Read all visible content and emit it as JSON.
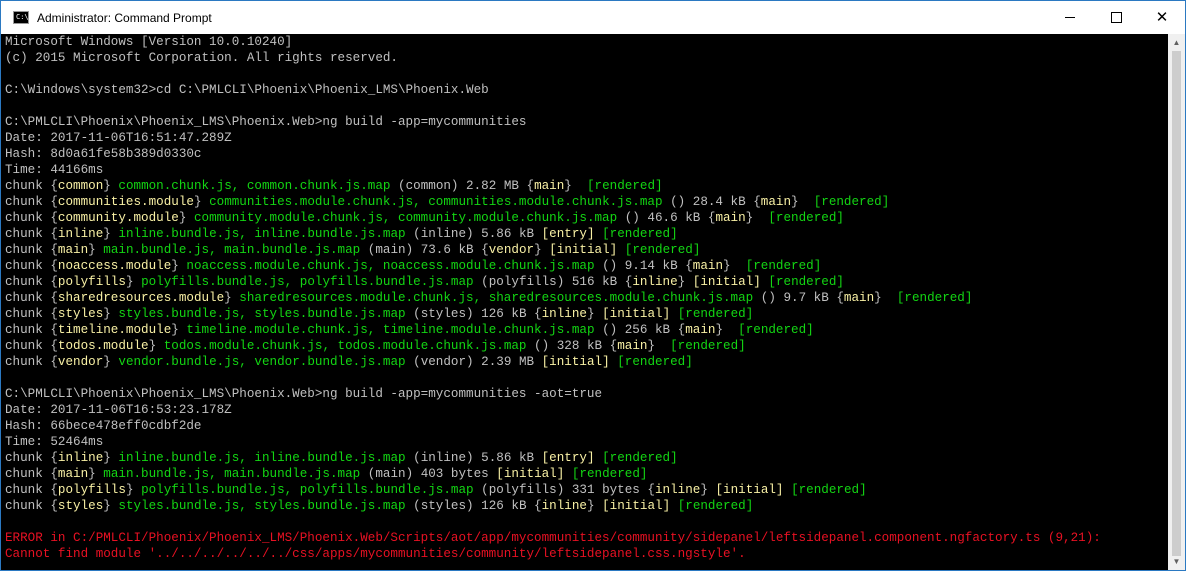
{
  "window": {
    "title": "Administrator: Command Prompt",
    "app_icon_text": "C:\\_",
    "controls": {
      "minimize": "minimize",
      "maximize": "maximize",
      "close": "✕"
    }
  },
  "colors": {
    "gray": "#c0c0c0",
    "green": "#13d613",
    "yellow": "#f9f1a5",
    "red": "#e81123"
  },
  "console": {
    "lines": [
      [
        [
          "gray",
          "Microsoft Windows [Version 10.0.10240]"
        ]
      ],
      [
        [
          "gray",
          "(c) 2015 Microsoft Corporation. All rights reserved."
        ]
      ],
      [],
      [
        [
          "gray",
          "C:\\Windows\\system32>cd C:\\PMLCLI\\Phoenix\\Phoenix_LMS\\Phoenix.Web"
        ]
      ],
      [],
      [
        [
          "gray",
          "C:\\PMLCLI\\Phoenix\\Phoenix_LMS\\Phoenix.Web>ng build -app=mycommunities"
        ]
      ],
      [
        [
          "gray",
          "Date: 2017-11-06T16:51:47.289Z"
        ]
      ],
      [
        [
          "gray",
          "Hash: 8d0a61fe58b389d0330c"
        ]
      ],
      [
        [
          "gray",
          "Time: 44166ms"
        ]
      ],
      [
        [
          "gray",
          "chunk {"
        ],
        [
          "yellow",
          "common"
        ],
        [
          "gray",
          "} "
        ],
        [
          "green",
          "common.chunk.js, common.chunk.js.map"
        ],
        [
          "gray",
          " (common) 2.82 MB {"
        ],
        [
          "yellow",
          "main"
        ],
        [
          "gray",
          "}  "
        ],
        [
          "green",
          "[rendered]"
        ]
      ],
      [
        [
          "gray",
          "chunk {"
        ],
        [
          "yellow",
          "communities.module"
        ],
        [
          "gray",
          "} "
        ],
        [
          "green",
          "communities.module.chunk.js, communities.module.chunk.js.map"
        ],
        [
          "gray",
          " () 28.4 kB {"
        ],
        [
          "yellow",
          "main"
        ],
        [
          "gray",
          "}  "
        ],
        [
          "green",
          "[rendered]"
        ]
      ],
      [
        [
          "gray",
          "chunk {"
        ],
        [
          "yellow",
          "community.module"
        ],
        [
          "gray",
          "} "
        ],
        [
          "green",
          "community.module.chunk.js, community.module.chunk.js.map"
        ],
        [
          "gray",
          " () 46.6 kB {"
        ],
        [
          "yellow",
          "main"
        ],
        [
          "gray",
          "}  "
        ],
        [
          "green",
          "[rendered]"
        ]
      ],
      [
        [
          "gray",
          "chunk {"
        ],
        [
          "yellow",
          "inline"
        ],
        [
          "gray",
          "} "
        ],
        [
          "green",
          "inline.bundle.js, inline.bundle.js.map"
        ],
        [
          "gray",
          " (inline) 5.86 kB "
        ],
        [
          "yellow",
          "[entry]"
        ],
        [
          "gray",
          " "
        ],
        [
          "green",
          "[rendered]"
        ]
      ],
      [
        [
          "gray",
          "chunk {"
        ],
        [
          "yellow",
          "main"
        ],
        [
          "gray",
          "} "
        ],
        [
          "green",
          "main.bundle.js, main.bundle.js.map"
        ],
        [
          "gray",
          " (main) 73.6 kB {"
        ],
        [
          "yellow",
          "vendor"
        ],
        [
          "gray",
          "} "
        ],
        [
          "yellow",
          "[initial]"
        ],
        [
          "gray",
          " "
        ],
        [
          "green",
          "[rendered]"
        ]
      ],
      [
        [
          "gray",
          "chunk {"
        ],
        [
          "yellow",
          "noaccess.module"
        ],
        [
          "gray",
          "} "
        ],
        [
          "green",
          "noaccess.module.chunk.js, noaccess.module.chunk.js.map"
        ],
        [
          "gray",
          " () 9.14 kB {"
        ],
        [
          "yellow",
          "main"
        ],
        [
          "gray",
          "}  "
        ],
        [
          "green",
          "[rendered]"
        ]
      ],
      [
        [
          "gray",
          "chunk {"
        ],
        [
          "yellow",
          "polyfills"
        ],
        [
          "gray",
          "} "
        ],
        [
          "green",
          "polyfills.bundle.js, polyfills.bundle.js.map"
        ],
        [
          "gray",
          " (polyfills) 516 kB {"
        ],
        [
          "yellow",
          "inline"
        ],
        [
          "gray",
          "} "
        ],
        [
          "yellow",
          "[initial]"
        ],
        [
          "gray",
          " "
        ],
        [
          "green",
          "[rendered]"
        ]
      ],
      [
        [
          "gray",
          "chunk {"
        ],
        [
          "yellow",
          "sharedresources.module"
        ],
        [
          "gray",
          "} "
        ],
        [
          "green",
          "sharedresources.module.chunk.js, sharedresources.module.chunk.js.map"
        ],
        [
          "gray",
          " () 9.7 kB {"
        ],
        [
          "yellow",
          "main"
        ],
        [
          "gray",
          "}  "
        ],
        [
          "green",
          "[rendered]"
        ]
      ],
      [
        [
          "gray",
          "chunk {"
        ],
        [
          "yellow",
          "styles"
        ],
        [
          "gray",
          "} "
        ],
        [
          "green",
          "styles.bundle.js, styles.bundle.js.map"
        ],
        [
          "gray",
          " (styles) 126 kB {"
        ],
        [
          "yellow",
          "inline"
        ],
        [
          "gray",
          "} "
        ],
        [
          "yellow",
          "[initial]"
        ],
        [
          "gray",
          " "
        ],
        [
          "green",
          "[rendered]"
        ]
      ],
      [
        [
          "gray",
          "chunk {"
        ],
        [
          "yellow",
          "timeline.module"
        ],
        [
          "gray",
          "} "
        ],
        [
          "green",
          "timeline.module.chunk.js, timeline.module.chunk.js.map"
        ],
        [
          "gray",
          " () 256 kB {"
        ],
        [
          "yellow",
          "main"
        ],
        [
          "gray",
          "}  "
        ],
        [
          "green",
          "[rendered]"
        ]
      ],
      [
        [
          "gray",
          "chunk {"
        ],
        [
          "yellow",
          "todos.module"
        ],
        [
          "gray",
          "} "
        ],
        [
          "green",
          "todos.module.chunk.js, todos.module.chunk.js.map"
        ],
        [
          "gray",
          " () 328 kB {"
        ],
        [
          "yellow",
          "main"
        ],
        [
          "gray",
          "}  "
        ],
        [
          "green",
          "[rendered]"
        ]
      ],
      [
        [
          "gray",
          "chunk {"
        ],
        [
          "yellow",
          "vendor"
        ],
        [
          "gray",
          "} "
        ],
        [
          "green",
          "vendor.bundle.js, vendor.bundle.js.map"
        ],
        [
          "gray",
          " (vendor) 2.39 MB "
        ],
        [
          "yellow",
          "[initial]"
        ],
        [
          "gray",
          " "
        ],
        [
          "green",
          "[rendered]"
        ]
      ],
      [],
      [
        [
          "gray",
          "C:\\PMLCLI\\Phoenix\\Phoenix_LMS\\Phoenix.Web>ng build -app=mycommunities -aot=true"
        ]
      ],
      [
        [
          "gray",
          "Date: 2017-11-06T16:53:23.178Z"
        ]
      ],
      [
        [
          "gray",
          "Hash: 66bece478eff0cdbf2de"
        ]
      ],
      [
        [
          "gray",
          "Time: 52464ms"
        ]
      ],
      [
        [
          "gray",
          "chunk {"
        ],
        [
          "yellow",
          "inline"
        ],
        [
          "gray",
          "} "
        ],
        [
          "green",
          "inline.bundle.js, inline.bundle.js.map"
        ],
        [
          "gray",
          " (inline) 5.86 kB "
        ],
        [
          "yellow",
          "[entry]"
        ],
        [
          "gray",
          " "
        ],
        [
          "green",
          "[rendered]"
        ]
      ],
      [
        [
          "gray",
          "chunk {"
        ],
        [
          "yellow",
          "main"
        ],
        [
          "gray",
          "} "
        ],
        [
          "green",
          "main.bundle.js, main.bundle.js.map"
        ],
        [
          "gray",
          " (main) 403 bytes "
        ],
        [
          "yellow",
          "[initial]"
        ],
        [
          "gray",
          " "
        ],
        [
          "green",
          "[rendered]"
        ]
      ],
      [
        [
          "gray",
          "chunk {"
        ],
        [
          "yellow",
          "polyfills"
        ],
        [
          "gray",
          "} "
        ],
        [
          "green",
          "polyfills.bundle.js, polyfills.bundle.js.map"
        ],
        [
          "gray",
          " (polyfills) 331 bytes {"
        ],
        [
          "yellow",
          "inline"
        ],
        [
          "gray",
          "} "
        ],
        [
          "yellow",
          "[initial]"
        ],
        [
          "gray",
          " "
        ],
        [
          "green",
          "[rendered]"
        ]
      ],
      [
        [
          "gray",
          "chunk {"
        ],
        [
          "yellow",
          "styles"
        ],
        [
          "gray",
          "} "
        ],
        [
          "green",
          "styles.bundle.js, styles.bundle.js.map"
        ],
        [
          "gray",
          " (styles) 126 kB {"
        ],
        [
          "yellow",
          "inline"
        ],
        [
          "gray",
          "} "
        ],
        [
          "yellow",
          "[initial]"
        ],
        [
          "gray",
          " "
        ],
        [
          "green",
          "[rendered]"
        ]
      ],
      [],
      [
        [
          "red",
          "ERROR in C:/PMLCLI/Phoenix/Phoenix_LMS/Phoenix.Web/Scripts/aot/app/mycommunities/community/sidepanel/leftsidepanel.component.ngfactory.ts (9,21):"
        ]
      ],
      [
        [
          "red",
          "Cannot find module '../../../../../../css/apps/mycommunities/community/leftsidepanel.css.ngstyle'."
        ]
      ]
    ]
  }
}
